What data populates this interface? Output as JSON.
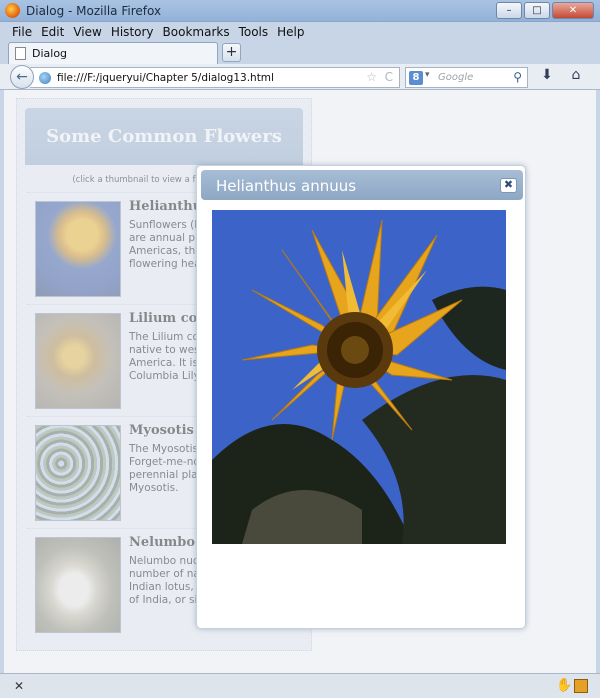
{
  "window": {
    "title": "Dialog - Mozilla Firefox",
    "controls": {
      "minimize": "–",
      "maximize": "□",
      "close": "✕"
    }
  },
  "menu": {
    "items": [
      "File",
      "Edit",
      "View",
      "History",
      "Bookmarks",
      "Tools",
      "Help"
    ]
  },
  "tabs": [
    {
      "label": "Dialog"
    }
  ],
  "new_tab": "+",
  "nav": {
    "back": "←",
    "url": "file:///F:/jqueryui/Chapter 5/dialog13.html",
    "star": "☆",
    "reload": "C",
    "search_engine": "8",
    "search_placeholder": "Google",
    "search_icon": "⚲",
    "download_icon": "⬇",
    "home_icon": "⌂"
  },
  "page": {
    "heading": "Some Common Flowers",
    "hint": "(click a thumbnail to view a full-size image)",
    "flowers": [
      {
        "name": "Helianthus annuus",
        "desc": "Sunflowers (Helianthus annuus) are annual plants native to the Americas, that possess a large flowering head",
        "thumb": "sunflower"
      },
      {
        "name": "Lilium columbianum",
        "desc": "The Lilium columbianum is a lily native to western North America. It is also known as the Columbia Lily or Tiger Lily",
        "thumb": "lily"
      },
      {
        "name": "Myosotis scorpioides",
        "desc": "The Myosotis scorpioides, or Forget-me-not, is a herbaceous perennial plant of the genus Myosotis.",
        "thumb": "forget-me-not"
      },
      {
        "name": "Nelumbo nucifera",
        "desc": "Nelumbo nucifera is known by a number of names including; Indian lotus, sacred lotus, bean of India, or simply lotus.",
        "thumb": "lotus"
      }
    ]
  },
  "dialog": {
    "title": "Helianthus annuus",
    "close_label": "✖",
    "image": "sunflower"
  },
  "status": {
    "close": "✕",
    "hand_icon": "✋"
  },
  "colors": {
    "chrome": "#c7d5e6",
    "dialog_header": "#94aecb",
    "sky": "#3c63c8",
    "petal": "#e7a51d"
  }
}
